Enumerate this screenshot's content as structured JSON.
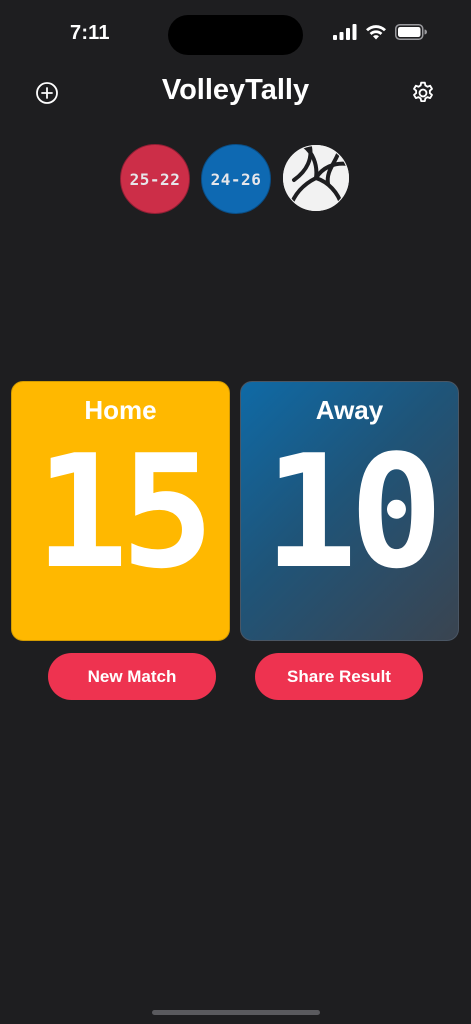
{
  "status_bar": {
    "time": "7:11"
  },
  "header": {
    "title": "VolleyTally",
    "add_icon": "plus-circle-icon",
    "settings_icon": "gear-icon"
  },
  "set_history": [
    {
      "label": "25-22",
      "color": "#cc2e48"
    },
    {
      "label": "24-26",
      "color": "#0e69b2"
    }
  ],
  "serving_indicator": "volleyball-icon",
  "teams": {
    "home": {
      "name": "Home",
      "score": "15",
      "color": "#ffb800"
    },
    "away": {
      "name": "Away",
      "score": "10",
      "color": "#1f5478"
    }
  },
  "actions": {
    "new_match": "New Match",
    "share_result": "Share Result",
    "color": "#ee3350"
  }
}
